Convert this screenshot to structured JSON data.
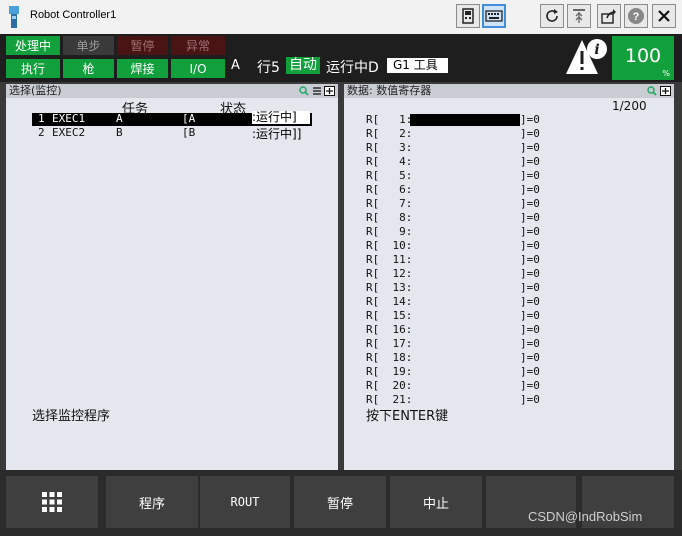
{
  "window": {
    "title": "Robot Controller1"
  },
  "status": {
    "row1": [
      "处理中",
      "单步",
      "暂停",
      "异常"
    ],
    "row2": [
      "执行",
      "枪",
      "焊接",
      "I/O"
    ],
    "prog_letter": "A",
    "line": "行5",
    "mode": "自动",
    "run_state": "运行中D",
    "group_tool": "G1 工具",
    "speed": "100",
    "speed_unit": "%"
  },
  "left_panel": {
    "title": "选择(监控)",
    "col_task": "任务",
    "col_state": "状态",
    "rows": [
      {
        "idx": "1",
        "name": "EXEC1",
        "task": "A",
        "bracket": "[A",
        "state": ":运行中]"
      },
      {
        "idx": "2",
        "name": "EXEC2",
        "task": "B",
        "bracket": "[B",
        "state": ":运行中]]"
      }
    ],
    "prompt": "选择监控程序"
  },
  "right_panel": {
    "title": "数据: 数值寄存器",
    "page": "1/200",
    "registers": [
      {
        "num": "1",
        "value": "0"
      },
      {
        "num": "2",
        "value": "0"
      },
      {
        "num": "3",
        "value": "0"
      },
      {
        "num": "4",
        "value": "0"
      },
      {
        "num": "5",
        "value": "0"
      },
      {
        "num": "6",
        "value": "0"
      },
      {
        "num": "7",
        "value": "0"
      },
      {
        "num": "8",
        "value": "0"
      },
      {
        "num": "9",
        "value": "0"
      },
      {
        "num": "10",
        "value": "0"
      },
      {
        "num": "11",
        "value": "0"
      },
      {
        "num": "12",
        "value": "0"
      },
      {
        "num": "13",
        "value": "0"
      },
      {
        "num": "14",
        "value": "0"
      },
      {
        "num": "15",
        "value": "0"
      },
      {
        "num": "16",
        "value": "0"
      },
      {
        "num": "17",
        "value": "0"
      },
      {
        "num": "18",
        "value": "0"
      },
      {
        "num": "19",
        "value": "0"
      },
      {
        "num": "20",
        "value": "0"
      },
      {
        "num": "21",
        "value": "0"
      }
    ],
    "prompt": "按下ENTER键"
  },
  "function_keys": [
    "程序",
    "ROUT",
    "暂停",
    "中止"
  ],
  "watermark": "CSDN@IndRobSim",
  "icons": [
    "robot-app-icon",
    "teach-pendant-icon",
    "keyboard-icon",
    "refresh-icon",
    "antenna-icon",
    "share-icon",
    "help-icon",
    "close-icon",
    "warning-info-icon",
    "zoom-icon",
    "list-icon",
    "maximize-icon",
    "grid-menu-icon"
  ],
  "colors": {
    "status_green": "#12a03d",
    "status_dark_red": "#4a1414",
    "panel_bg": "#e4e8ee"
  }
}
